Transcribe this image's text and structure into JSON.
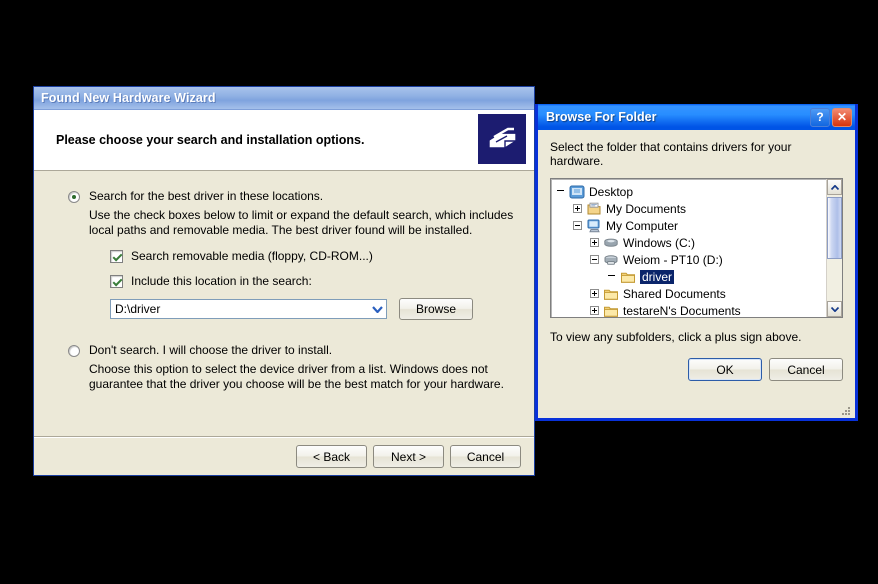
{
  "wizard": {
    "title": "Found New Hardware Wizard",
    "header": "Please choose your search and installation options.",
    "header_icon": "hardware-device-icon",
    "option_search": {
      "label": "Search for the best driver in these locations.",
      "selected": true,
      "description": "Use the check boxes below to limit or expand the default search, which includes local paths and removable media. The best driver found will be installed.",
      "checkbox_removable": {
        "label": "Search removable media (floppy, CD-ROM...)",
        "checked": true
      },
      "checkbox_location": {
        "label": "Include this location in the search:",
        "checked": true
      },
      "location_value": "D:\\driver",
      "browse_label": "Browse"
    },
    "option_manual": {
      "label": "Don't search.  I will choose the driver to install.",
      "selected": false,
      "description": "Choose this option to select the device driver from a list.  Windows does not guarantee that the driver you choose will be the best match for your hardware."
    },
    "buttons": {
      "back": "< Back",
      "next": "Next >",
      "cancel": "Cancel"
    }
  },
  "browse_dialog": {
    "title": "Browse For Folder",
    "help_glyph": "?",
    "close_glyph": "✕",
    "prompt": "Select the folder that contains drivers for your hardware.",
    "hint": "To view any subfolders, click a plus sign above.",
    "tree": [
      {
        "label": "Desktop",
        "indent": 0,
        "expander": "none",
        "icon": "desktop-icon",
        "selected": false
      },
      {
        "label": "My Documents",
        "indent": 1,
        "expander": "plus",
        "icon": "my-documents-icon",
        "selected": false
      },
      {
        "label": "My Computer",
        "indent": 1,
        "expander": "minus",
        "icon": "my-computer-icon",
        "selected": false
      },
      {
        "label": "Windows (C:)",
        "indent": 2,
        "expander": "plus",
        "icon": "hard-drive-icon",
        "selected": false
      },
      {
        "label": "Weiom - PT10 (D:)",
        "indent": 2,
        "expander": "minus",
        "icon": "removable-drive-icon",
        "selected": false
      },
      {
        "label": "driver",
        "indent": 3,
        "expander": "none",
        "icon": "folder-icon",
        "selected": true
      },
      {
        "label": "Shared Documents",
        "indent": 2,
        "expander": "plus",
        "icon": "folder-icon",
        "selected": false
      },
      {
        "label": "testareN's Documents",
        "indent": 2,
        "expander": "plus",
        "icon": "folder-icon",
        "selected": false
      }
    ],
    "buttons": {
      "ok": "OK",
      "cancel": "Cancel"
    }
  },
  "colors": {
    "dialog_face": "#ece9d8",
    "active_title": "#0054e6",
    "inactive_title": "#8fb0e3",
    "selection": "#0a246a",
    "close_button": "#d8340d"
  }
}
